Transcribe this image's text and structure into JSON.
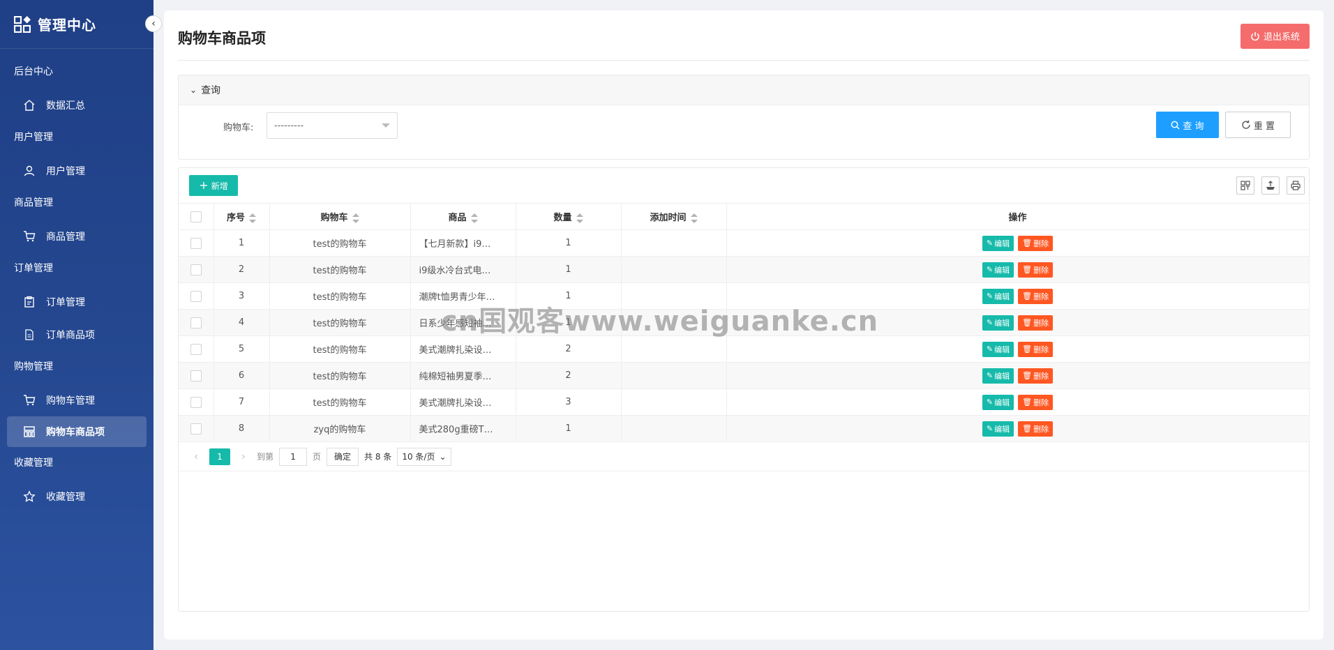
{
  "sidebar": {
    "title": "管理中心",
    "groups": [
      {
        "label": "后台中心",
        "items": [
          {
            "label": "数据汇总",
            "icon": "home-icon"
          }
        ]
      },
      {
        "label": "用户管理",
        "items": [
          {
            "label": "用户管理",
            "icon": "user-icon"
          }
        ]
      },
      {
        "label": "商品管理",
        "items": [
          {
            "label": "商品管理",
            "icon": "cart-icon"
          }
        ]
      },
      {
        "label": "订单管理",
        "items": [
          {
            "label": "订单管理",
            "icon": "clipboard-icon"
          },
          {
            "label": "订单商品项",
            "icon": "document-icon"
          }
        ]
      },
      {
        "label": "购物管理",
        "items": [
          {
            "label": "购物车管理",
            "icon": "cart-icon"
          },
          {
            "label": "购物车商品项",
            "icon": "grid-icon",
            "active": true
          }
        ]
      },
      {
        "label": "收藏管理",
        "items": [
          {
            "label": "收藏管理",
            "icon": "star-icon"
          }
        ]
      }
    ]
  },
  "header": {
    "title": "购物车商品项",
    "logout_label": "退出系统",
    "accent": "#f56c6c"
  },
  "query": {
    "panel_title": "查询",
    "cart_label": "购物车:",
    "cart_value": "---------",
    "query_label": "查 询",
    "reset_label": "重 置"
  },
  "toolbar": {
    "add_label": "新增"
  },
  "table": {
    "columns": [
      "序号",
      "购物车",
      "商品",
      "数量",
      "添加时间",
      "操作"
    ],
    "rows": [
      {
        "id": "1",
        "cart": "test的购物车",
        "goods": "【七月新款】i9…",
        "qty": "1",
        "time": ""
      },
      {
        "id": "2",
        "cart": "test的购物车",
        "goods": "i9级水冷台式电…",
        "qty": "1",
        "time": ""
      },
      {
        "id": "3",
        "cart": "test的购物车",
        "goods": "潮牌t恤男青少年…",
        "qty": "1",
        "time": ""
      },
      {
        "id": "4",
        "cart": "test的购物车",
        "goods": "日系少年感短袖…",
        "qty": "1",
        "time": ""
      },
      {
        "id": "5",
        "cart": "test的购物车",
        "goods": "美式潮牌扎染设…",
        "qty": "2",
        "time": ""
      },
      {
        "id": "6",
        "cart": "test的购物车",
        "goods": "纯棉短袖男夏季…",
        "qty": "2",
        "time": ""
      },
      {
        "id": "7",
        "cart": "test的购物车",
        "goods": "美式潮牌扎染设…",
        "qty": "3",
        "time": ""
      },
      {
        "id": "8",
        "cart": "zyq的购物车",
        "goods": "美式280g重磅T…",
        "qty": "1",
        "time": ""
      }
    ],
    "edit_label": "编辑",
    "delete_label": "删除"
  },
  "pager": {
    "current": "1",
    "goto_label": "到第",
    "page_input": "1",
    "page_unit": "页",
    "ok_label": "确定",
    "total": "共 8 条",
    "page_size": "10 条/页"
  },
  "watermark": "cn国观客www.weiguanke.cn"
}
